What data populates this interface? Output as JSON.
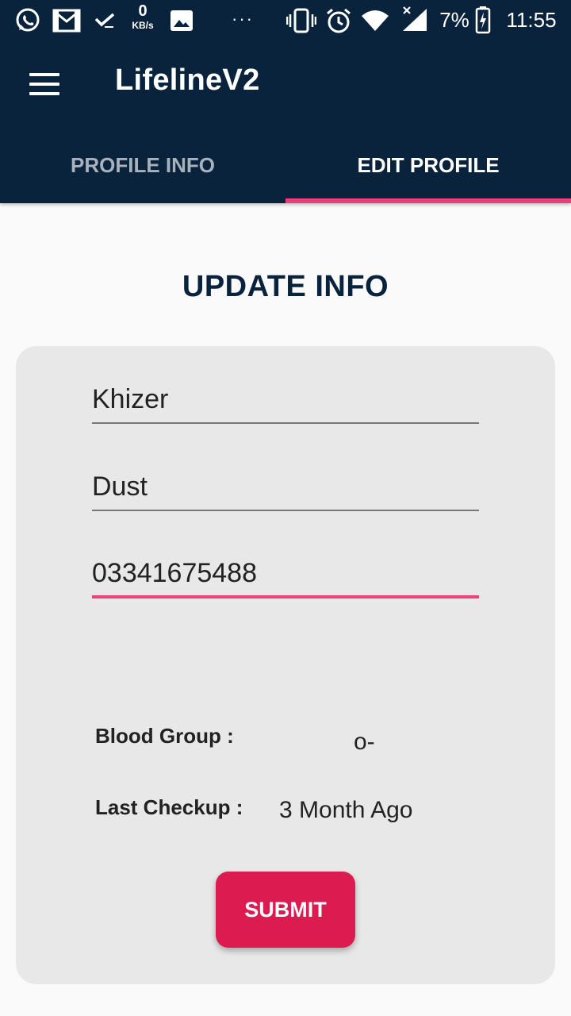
{
  "status_bar": {
    "icons": [
      "whatsapp-icon",
      "gmail-icon",
      "check-icon",
      "image-icon",
      "more-dots-icon",
      "vibrate-icon",
      "alarm-icon",
      "wifi-icon",
      "signal-icon",
      "battery-charging-icon"
    ],
    "speed_value": "0",
    "speed_unit": "KB/s",
    "dots": "···",
    "battery": "7%",
    "time": "11:55"
  },
  "app_bar": {
    "title": "LifelineV2",
    "menu_icon": "hamburger-menu-icon"
  },
  "tabs": [
    {
      "label": "PROFILE INFO",
      "selected": false
    },
    {
      "label": "EDIT PROFILE",
      "selected": true
    }
  ],
  "main": {
    "title": "UPDATE INFO",
    "form": {
      "first_name": "Khizer",
      "last_name": "Dust",
      "phone": "03341675488",
      "blood_group_label": "Blood Group :",
      "blood_group_value": "o-",
      "last_checkup_label": "Last Checkup :",
      "last_checkup_value": "3 Month Ago",
      "submit_label": "SUBMIT"
    }
  },
  "colors": {
    "primary": "#0a233c",
    "accent": "#ec407a",
    "button": "#dc1c50",
    "card": "#e8e8e8",
    "background": "#fafafa"
  }
}
